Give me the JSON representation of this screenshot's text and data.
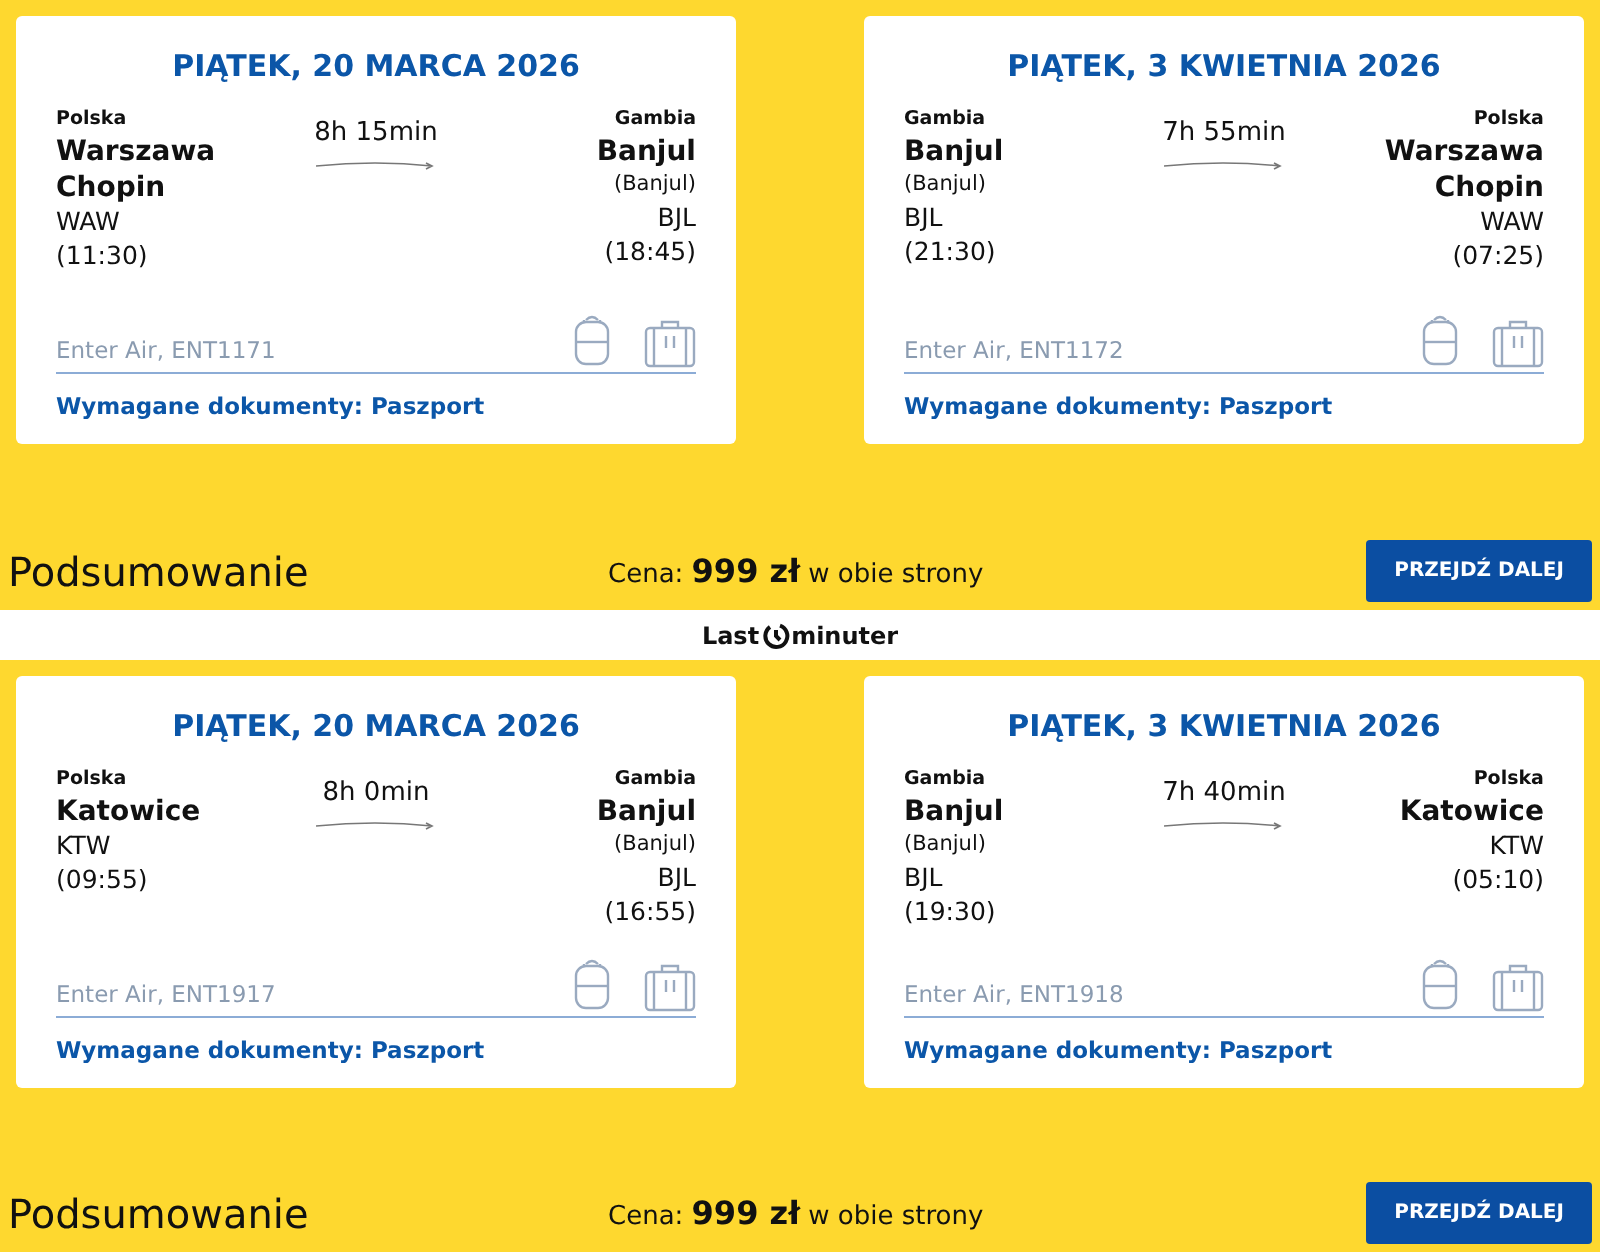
{
  "sections": [
    {
      "flights": [
        {
          "date": "PIĄTEK, 20 MARCA 2026",
          "duration": "8h 15min",
          "carrier": "Enter Air, ENT1171",
          "documents": "Wymagane dokumenty: Paszport",
          "from": {
            "country": "Polska",
            "city": "Warszawa Chopin",
            "code": "WAW",
            "time": "(11:30)"
          },
          "to": {
            "country": "Gambia",
            "city": "Banjul",
            "subtitle": "(Banjul)",
            "code": "BJL",
            "time": "(18:45)"
          }
        },
        {
          "date": "PIĄTEK, 3 KWIETNIA 2026",
          "duration": "7h 55min",
          "carrier": "Enter Air, ENT1172",
          "documents": "Wymagane dokumenty: Paszport",
          "from": {
            "country": "Gambia",
            "city": "Banjul",
            "subtitle": "(Banjul)",
            "code": "BJL",
            "time": "(21:30)"
          },
          "to": {
            "country": "Polska",
            "city": "Warszawa Chopin",
            "code": "WAW",
            "time": "(07:25)"
          }
        }
      ],
      "summary": {
        "title": "Podsumowanie",
        "price": "Cena: **999 zł** w obie strony",
        "button": "PRZEJDŹ DALEJ"
      }
    },
    {
      "flights": [
        {
          "date": "PIĄTEK, 20 MARCA 2026",
          "duration": "8h 0min",
          "carrier": "Enter Air, ENT1917",
          "documents": "Wymagane dokumenty: Paszport",
          "from": {
            "country": "Polska",
            "city": "Katowice",
            "code": "KTW",
            "time": "(09:55)"
          },
          "to": {
            "country": "Gambia",
            "city": "Banjul",
            "subtitle": "(Banjul)",
            "code": "BJL",
            "time": "(16:55)"
          }
        },
        {
          "date": "PIĄTEK, 3 KWIETNIA 2026",
          "duration": "7h 40min",
          "carrier": "Enter Air, ENT1918",
          "documents": "Wymagane dokumenty: Paszport",
          "from": {
            "country": "Gambia",
            "city": "Banjul",
            "subtitle": "(Banjul)",
            "code": "BJL",
            "time": "(19:30)"
          },
          "to": {
            "country": "Polska",
            "city": "Katowice",
            "code": "KTW",
            "time": "(05:10)"
          }
        }
      ],
      "summary": {
        "title": "Podsumowanie",
        "price": "Cena: **999 zł** w obie strony",
        "button": "PRZEJDŹ DALEJ"
      }
    }
  ],
  "logo": {
    "left": "Last",
    "right": "minuter"
  }
}
